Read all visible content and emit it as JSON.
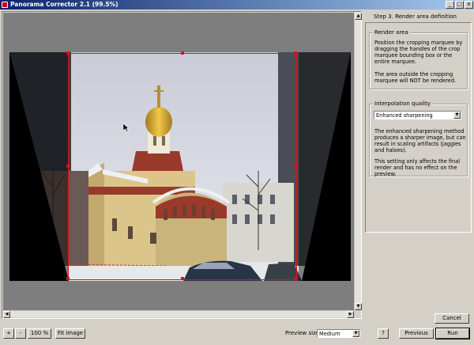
{
  "window": {
    "title": "Panorama Corrector 2.1 (99.5%)",
    "minimize_glyph": "_",
    "maximize_glyph": "□",
    "close_glyph": "x"
  },
  "panel": {
    "step_title": "Step 3. Render area definition",
    "render_area": {
      "legend": "Render area",
      "text1": "Position the cropping marquee by dragging the handles of the crop marquee bounding box or the entire marquee.",
      "text2": "The area outside the cropping marquee will NOT be rendered."
    },
    "interpolation": {
      "legend": "Interpolation quality",
      "selected": "Enhanced sharpening",
      "text1": "The enhanced sharpening method produces a sharper image, but can result in scaling artifacts (jaggies and haloes).",
      "text2": "This setting only affects the final render and has no effect on the preview."
    }
  },
  "toolbar": {
    "zoom_in": "+",
    "zoom_out": "-",
    "zoom_100": "100 %",
    "fit_image": "Fit image",
    "preview_size_label": "Preview size:",
    "preview_size_value": "Medium",
    "help": "?",
    "previous": "Previous",
    "run": "Run",
    "cancel": "Cancel"
  },
  "icons": {
    "dropdown": "dropdown-arrow-icon",
    "scroll_up": "scroll-up-icon",
    "scroll_down": "scroll-down-icon",
    "scroll_left": "scroll-left-icon",
    "scroll_right": "scroll-right-icon"
  }
}
